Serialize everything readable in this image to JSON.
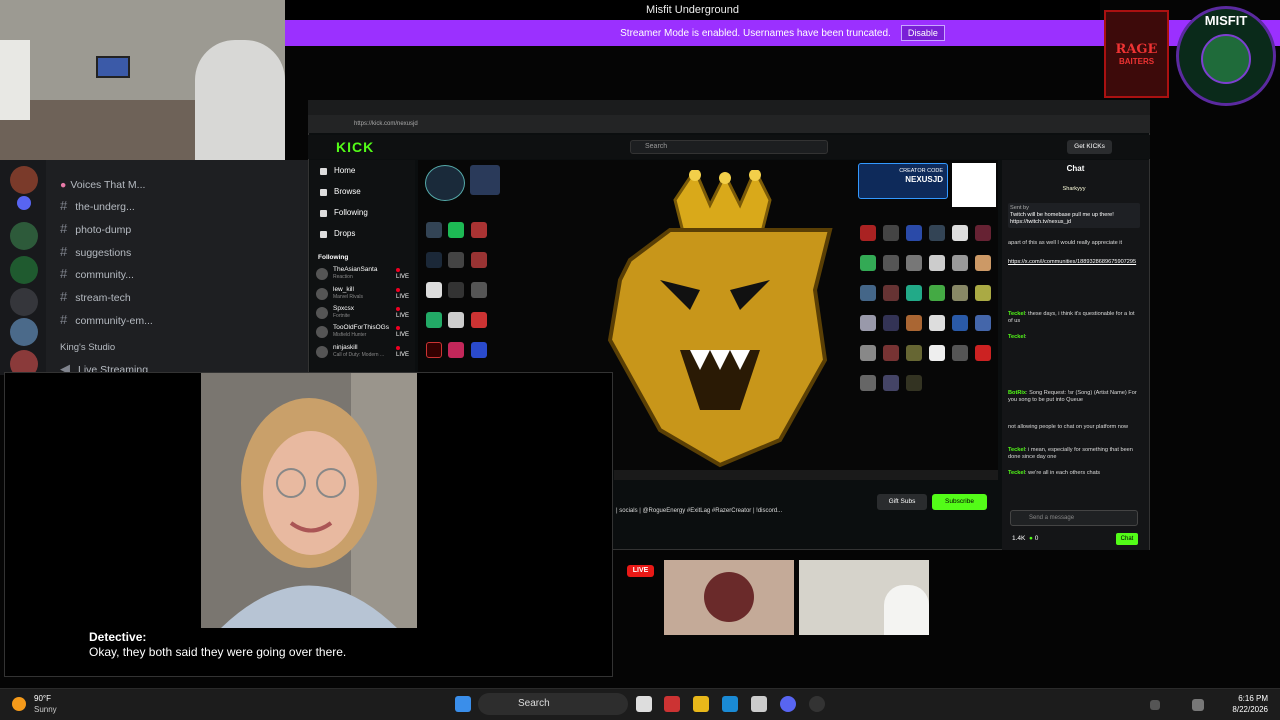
{
  "window": {
    "title": "Misfit Underground"
  },
  "banner": {
    "text": "Streamer Mode is enabled. Usernames have been truncated.",
    "button": "Disable"
  },
  "browser": {
    "url": "https://kick.com/nexusjd"
  },
  "discord": {
    "category1": "Voices That M...",
    "channels": [
      {
        "label": "the-underg..."
      },
      {
        "label": "photo-dump"
      },
      {
        "label": "suggestions"
      },
      {
        "label": "community..."
      },
      {
        "label": "stream-tech"
      },
      {
        "label": "community-em..."
      }
    ],
    "category2": "King's Studio",
    "voice_channel": "Live Streaming"
  },
  "kick": {
    "logo": "KICK",
    "search_placeholder": "Search",
    "get_kicks": "Get KICKs",
    "nav": [
      "Home",
      "Browse",
      "Following",
      "Drops"
    ],
    "following_header": "Following",
    "live_label": "LIVE",
    "following": [
      {
        "name": "TheAsianSanta",
        "game": "Reaction"
      },
      {
        "name": "lew_kill",
        "game": "Marvel Rivals"
      },
      {
        "name": "Spxcsx",
        "game": "Fortnite"
      },
      {
        "name": "TooOldForThisOGs",
        "game": "Misfield Hunter"
      },
      {
        "name": "ninjaskill",
        "game": "Call of Duty: Modern ..."
      }
    ],
    "creator_code_label": "CREATOR CODE",
    "creator_code": "NEXUSJD",
    "stream_tags": "| socials | @RogueEnergy #ExitLag #RazerCreator | !discord...",
    "gift_subs": "Gift Subs",
    "subscribe": "Subscribe"
  },
  "chat": {
    "title": "Chat",
    "pinned_user": "Sharkyyy",
    "sent_by": "Sent by",
    "pinned_text": "Twitch will be homebase pull me up there! https://twitch.tv/nexus_jd",
    "messages": [
      {
        "user": "",
        "text": "apart of this as well I would really appreciate it"
      },
      {
        "user": "",
        "text": "https://x.com/i/communities/1889328689675907295"
      },
      {
        "user": "Teckel",
        "text": "these days, i think it's questionable for a lot of us"
      },
      {
        "user": "Teckel",
        "text": ""
      },
      {
        "user": "BotRix",
        "text": "Song Request: !sr (Song) (Artist Name) For you song to be put into Queue"
      },
      {
        "user": "",
        "text": "not allowing people to chat on your platform now"
      },
      {
        "user": "Teckel",
        "text": "i mean, especially for something that been done since day one"
      },
      {
        "user": "Teckel",
        "text": "we're all in each others chats"
      }
    ],
    "input_placeholder": "Send a message",
    "viewers": "1.4K",
    "kicks": "0",
    "send_label": "Chat"
  },
  "captions": {
    "speaker": "Detective:",
    "text": "Okay, they both said they were going over there."
  },
  "live_badge": "LIVE",
  "taskbar": {
    "temp": "90°F",
    "condition": "Sunny",
    "search": "Search",
    "time": "6:16 PM",
    "date": "8/22/2026"
  },
  "colors": {
    "kick_green": "#53fc18",
    "banner_purple": "#9b30ff",
    "live_red": "#e91916"
  }
}
